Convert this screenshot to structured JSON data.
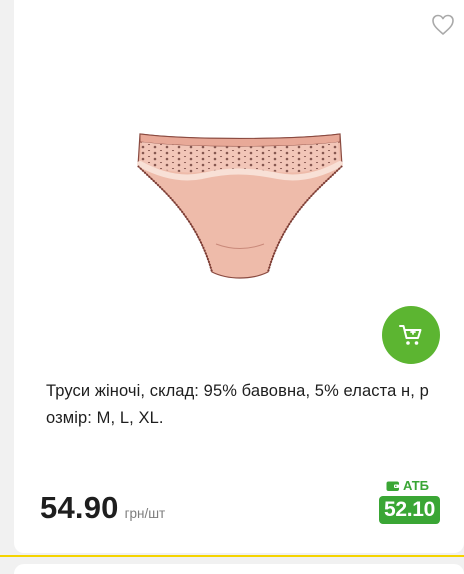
{
  "product": {
    "title": "Труси жіночі, склад: 95% бавовна, 5% еласта н, розмір: M, L, XL.",
    "price": "54.90",
    "unit": "грн/шт",
    "club_label": "АТБ",
    "club_price": "52.10",
    "image": "pink-womens-briefs-with-lace-and-polka-dots"
  },
  "icons": {
    "favorite": "heart-icon",
    "cart": "cart-icon",
    "club": "wallet-icon"
  },
  "colors": {
    "cart_button": "#5cb531",
    "club_price_bg": "#3aa635",
    "divider": "#f5d400"
  }
}
